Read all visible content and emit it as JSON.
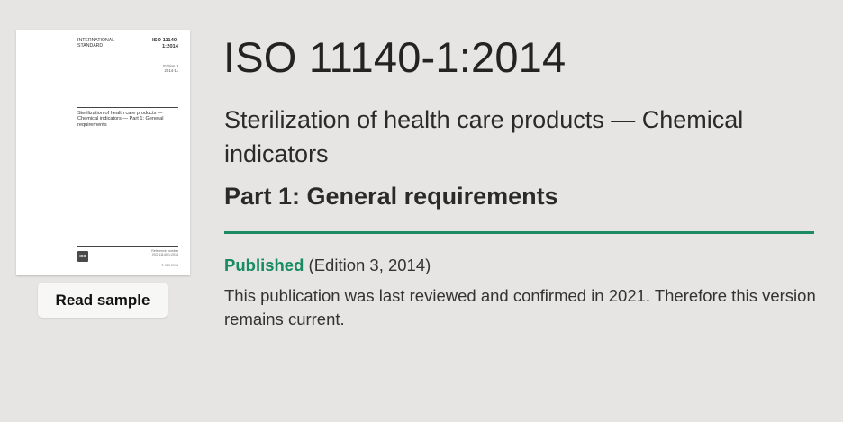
{
  "cover": {
    "standard_type": "INTERNATIONAL\nSTANDARD",
    "standard_number": "ISO 11140-\n1:2014",
    "edition": "Edition 3\n2014-11",
    "title": "Sterilization of health care products — Chemical indicators — Part 1: General requirements",
    "logo_text": "ISO",
    "reference_number": "Reference number\nISO 11140-1:2014",
    "copyright": "© ISO 2014"
  },
  "read_sample_label": "Read sample",
  "title": "ISO 11140-1:2014",
  "subtitle": "Sterilization of health care products — Chemical indicators",
  "part": "Part 1: General requirements",
  "status": {
    "label": "Published",
    "edition": "(Edition 3, 2014)"
  },
  "review_note": "This publication was last reviewed and confirmed in 2021. Therefore this version remains current.",
  "colors": {
    "background": "#e6e5e3",
    "accent_green": "#168c5f",
    "divider_green": "#1c8a62"
  }
}
